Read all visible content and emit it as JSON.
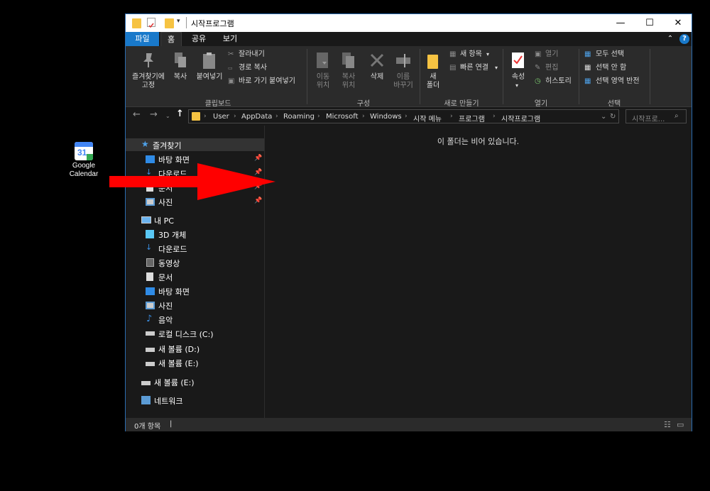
{
  "desktop": {
    "icons": [
      {
        "label": "Google Calendar",
        "number": "31"
      }
    ]
  },
  "window": {
    "title": "시작프로그램",
    "tabs": {
      "file": "파일",
      "home": "홈",
      "share": "공유",
      "view": "보기"
    },
    "controls": {
      "minimize": "—",
      "maximize": "☐",
      "close": "✕"
    },
    "ribbon": {
      "clipboard": {
        "pin": "즐겨찾기에\n고정",
        "copy": "복사",
        "paste": "붙여넣기",
        "cut": "잘라내기",
        "copy_path": "경로 복사",
        "paste_shortcut": "바로 가기 붙여넣기",
        "group": "클립보드"
      },
      "organize": {
        "move_to": "이동\n위치",
        "copy_to": "복사\n위치",
        "delete": "삭제",
        "rename": "이름\n바꾸기",
        "group": "구성"
      },
      "new": {
        "new_folder": "새\n폴더",
        "new_item": "새 항목",
        "easy_access": "빠른 연결",
        "group": "새로 만들기"
      },
      "open": {
        "properties": "속성",
        "open": "열기",
        "edit": "편집",
        "history": "히스토리",
        "group": "열기"
      },
      "select": {
        "select_all": "모두 선택",
        "select_none": "선택 안 함",
        "invert": "선택 영역 반전",
        "group": "선택"
      }
    },
    "address": {
      "crumbs": [
        "User",
        "AppData",
        "Roaming",
        "Microsoft",
        "Windows",
        "시작 메뉴",
        "프로그램",
        "시작프로그램"
      ],
      "search_placeholder": "시작프로..."
    },
    "nav": {
      "quick_access": "즐겨찾기",
      "qa_items": [
        "바탕 화면",
        "다운로드",
        "문서",
        "사진"
      ],
      "this_pc": "내 PC",
      "pc_items": [
        "3D 개체",
        "다운로드",
        "동영상",
        "문서",
        "바탕 화면",
        "사진",
        "음악",
        "로컬 디스크 (C:)",
        "새 볼륨 (D:)",
        "새 볼륨 (E:)"
      ],
      "drive_e": "새 볼륨 (E:)",
      "network": "네트워크"
    },
    "content": {
      "empty_message": "이 폴더는 비어 있습니다."
    },
    "status": {
      "item_count": "0개 항목"
    }
  },
  "colors": {
    "accent": "#1979ca",
    "arrow": "#ff0000",
    "folder": "#f6c342"
  }
}
